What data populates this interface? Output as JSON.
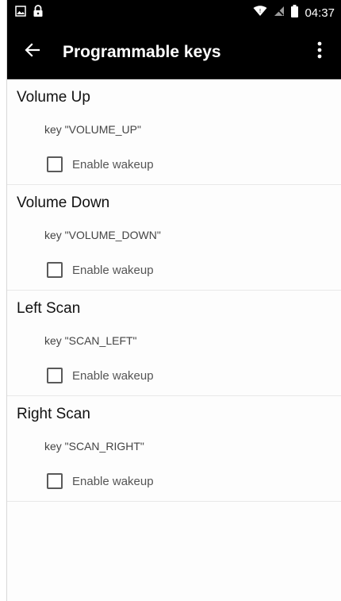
{
  "status_bar": {
    "time": "04:37",
    "icons": [
      "image-icon",
      "lock-icon",
      "wifi-icon",
      "no-signal-icon",
      "battery-icon"
    ]
  },
  "app_bar": {
    "title": "Programmable keys",
    "back_icon": "arrow-left-icon",
    "menu_icon": "more-vert-icon"
  },
  "keys": [
    {
      "title": "Volume Up",
      "code": "key \"VOLUME_UP\"",
      "wakeup_label": "Enable wakeup",
      "wakeup_checked": false
    },
    {
      "title": "Volume Down",
      "code": "key \"VOLUME_DOWN\"",
      "wakeup_label": "Enable wakeup",
      "wakeup_checked": false
    },
    {
      "title": "Left Scan",
      "code": "key \"SCAN_LEFT\"",
      "wakeup_label": "Enable wakeup",
      "wakeup_checked": false
    },
    {
      "title": "Right Scan",
      "code": "key \"SCAN_RIGHT\"",
      "wakeup_label": "Enable wakeup",
      "wakeup_checked": false
    }
  ],
  "colors": {
    "bar_background": "#000000",
    "bar_text": "#ffffff",
    "title_text": "#111111",
    "secondary_text": "#555555"
  }
}
